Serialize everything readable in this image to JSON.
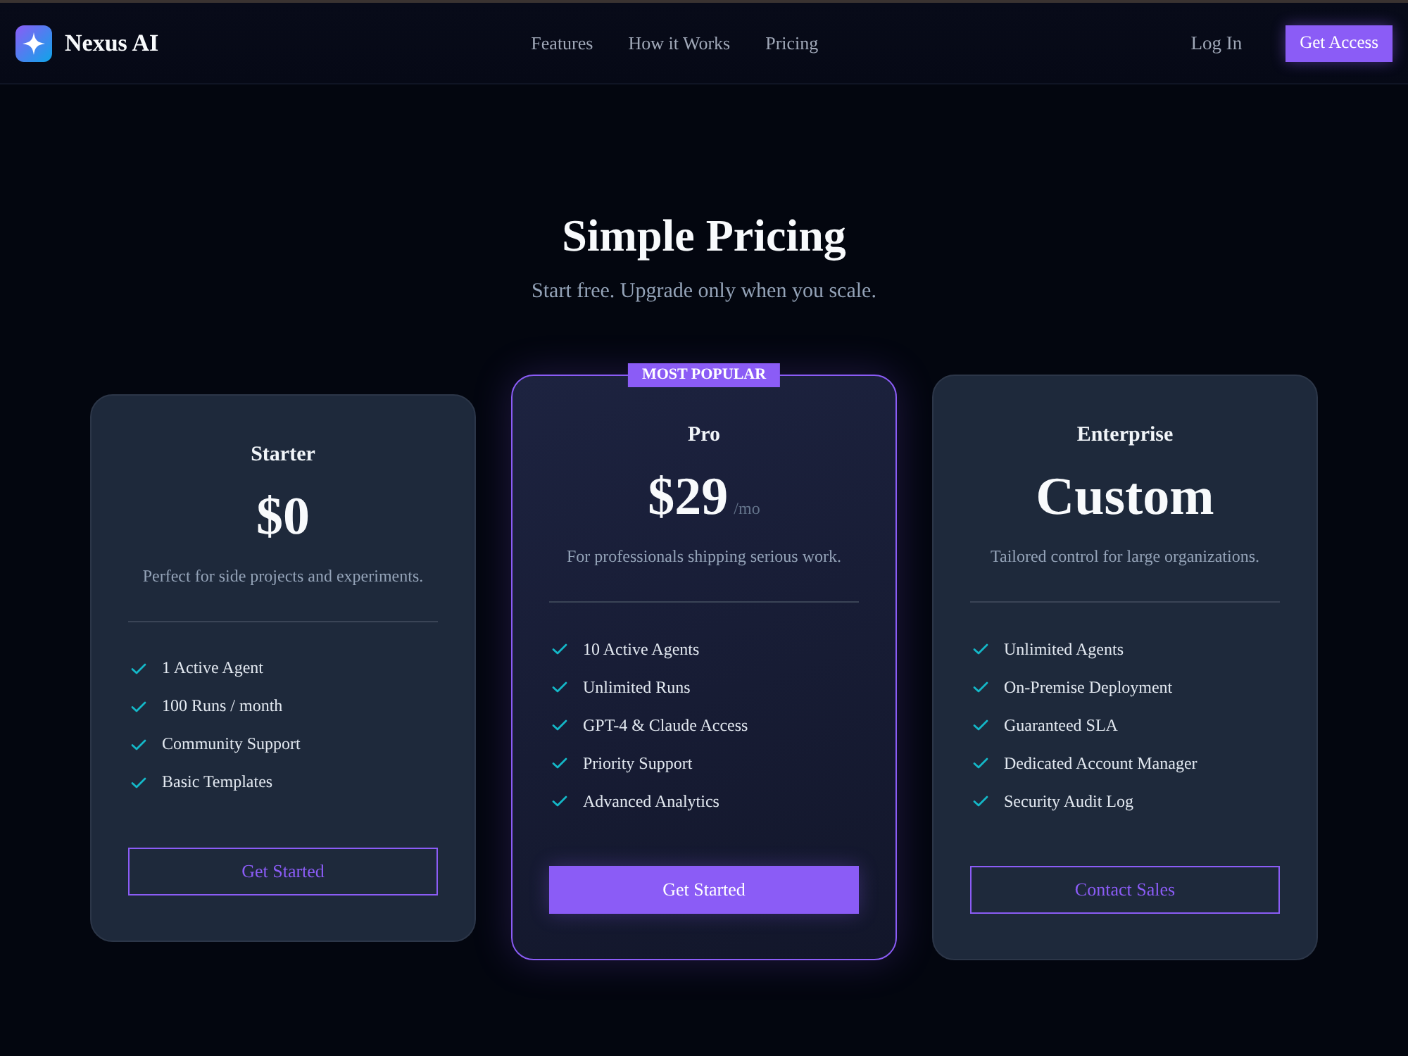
{
  "nav": {
    "brand": "Nexus AI",
    "links": [
      "Features",
      "How it Works",
      "Pricing"
    ],
    "login": "Log In",
    "cta": "Get Access"
  },
  "hero": {
    "title": "Simple Pricing",
    "subtitle": "Start free. Upgrade only when you scale."
  },
  "plans": [
    {
      "name": "Starter",
      "price": "$0",
      "description": "Perfect for side projects and experiments.",
      "features": [
        "1 Active Agent",
        "100 Runs / month",
        "Community Support",
        "Basic Templates"
      ],
      "button": "Get Started",
      "featured": false
    },
    {
      "name": "Pro",
      "badge": "MOST POPULAR",
      "price": "$29",
      "period": "/mo",
      "description": "For professionals shipping serious work.",
      "features": [
        "10 Active Agents",
        "Unlimited Runs",
        "GPT-4 & Claude Access",
        "Priority Support",
        "Advanced Analytics"
      ],
      "button": "Get Started",
      "featured": true
    },
    {
      "name": "Enterprise",
      "price": "Custom",
      "description": "Tailored control for large organizations.",
      "features": [
        "Unlimited Agents",
        "On-Premise Deployment",
        "Guaranteed SLA",
        "Dedicated Account Manager",
        "Security Audit Log"
      ],
      "button": "Contact Sales",
      "featured": false
    }
  ]
}
